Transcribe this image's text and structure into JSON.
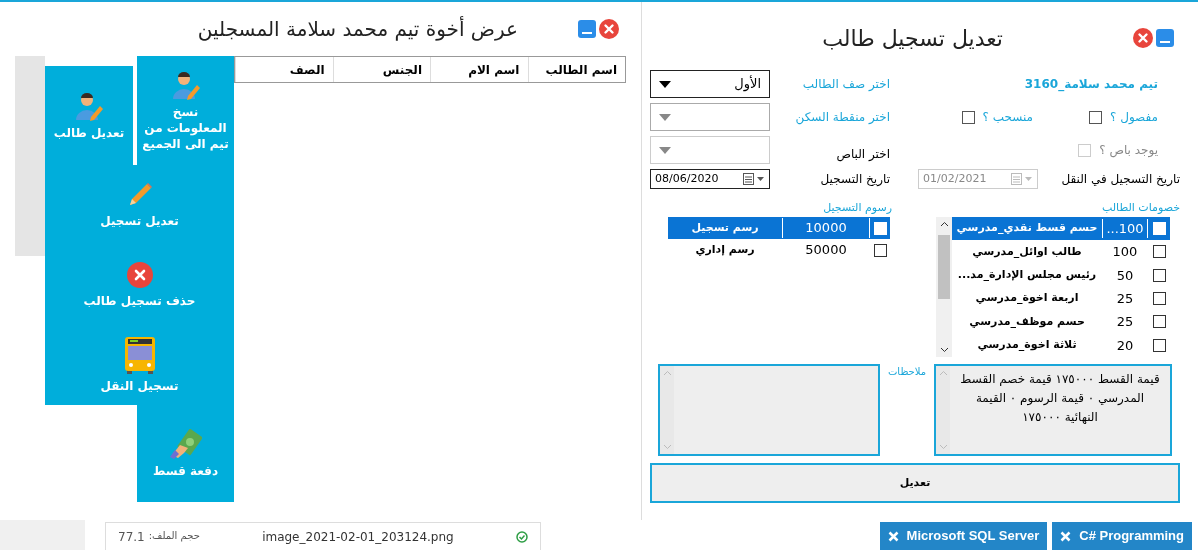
{
  "left_window": {
    "title": "عرض أخوة تيم محمد سلامة المسجلين",
    "table": {
      "columns": [
        "اسم الطالب",
        "اسم الام",
        "الجنس",
        "الصف"
      ]
    },
    "menu": {
      "top": [
        {
          "kind": "student",
          "label": "نسخ المعلومات من تيم الى الجميع"
        },
        {
          "kind": "student",
          "label": "تعديل طالب"
        }
      ],
      "middle": [
        {
          "kind": "pencil",
          "label": "تعديل تسجيل"
        },
        {
          "kind": "delete",
          "label": "حذف تسجيل طالب"
        },
        {
          "kind": "bus",
          "label": "تسجيل النقل"
        }
      ],
      "bottom": [
        {
          "kind": "money",
          "label": "دفعة قسط"
        }
      ]
    }
  },
  "right_window": {
    "title": "تعديل تسجيل طالب",
    "student_name": "تيم محمد سلامة_3160",
    "class_label": "اختر صف الطالب",
    "class_value": "الأول",
    "expelled": {
      "label": "مفصول ؟",
      "checked": false,
      "disabled": false
    },
    "withdrawn": {
      "label": "منسحب ؟",
      "checked": false,
      "disabled": false
    },
    "area_label": "اختر منقطة السكن",
    "has_bus": {
      "label": "يوجد باص ؟",
      "checked": false,
      "disabled": true
    },
    "bus_label": "اختر الباص",
    "transport_date_label": "تاريخ التسجيل في النقل",
    "transport_date": "01/02/2021",
    "registration_date_label": "تاريخ التسجيل",
    "registration_date": "08/06/2020",
    "discounts_label": "خصومات الطالب",
    "discounts": [
      {
        "amount": "100...",
        "name": "حسم قسط نقدي_مدرسي",
        "checked": false,
        "selected": true
      },
      {
        "amount": "100",
        "name": "طالب اوائل_مدرسي",
        "checked": false,
        "selected": false
      },
      {
        "amount": "50",
        "name": "رئيس مجلس الإدارة_مد...",
        "checked": false,
        "selected": false
      },
      {
        "amount": "25",
        "name": "اربعة اخوة_مدرسي",
        "checked": false,
        "selected": false
      },
      {
        "amount": "25",
        "name": "حسم موظف_مدرسي",
        "checked": false,
        "selected": false
      },
      {
        "amount": "20",
        "name": "ثلاثة اخوة_مدرسي",
        "checked": false,
        "selected": false
      }
    ],
    "fees_label": "رسوم التسجيل",
    "fees": [
      {
        "amount": "10000",
        "name": "رسم تسجيل",
        "checked": false,
        "selected": true
      },
      {
        "amount": "50000",
        "name": "رسم إداري",
        "checked": false,
        "selected": false
      }
    ],
    "summary": "قيمة القسط ١٧٥٠٠٠ قيمة خصم القسط المدرسي ٠ قيمة الرسوم ٠ القيمة النهائية ١٧٥٠٠٠",
    "notes_label": "ملاحظات",
    "submit": "تعديل"
  },
  "attachment": {
    "file_name": "image_2021-02-01_203124.png",
    "size_label": "حجم الملف:",
    "size": "77.1"
  },
  "tags": [
    "C# Programming",
    "Microsoft SQL Server"
  ]
}
